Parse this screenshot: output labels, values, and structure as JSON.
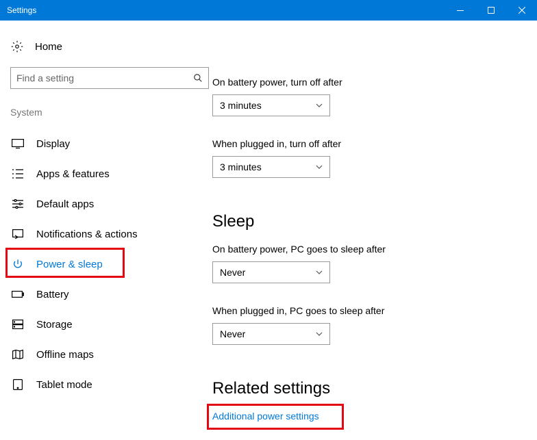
{
  "window": {
    "title": "Settings"
  },
  "home": {
    "label": "Home"
  },
  "search": {
    "placeholder": "Find a setting"
  },
  "section": {
    "label": "System"
  },
  "nav": {
    "items": [
      {
        "label": "Display"
      },
      {
        "label": "Apps & features"
      },
      {
        "label": "Default apps"
      },
      {
        "label": "Notifications & actions"
      },
      {
        "label": "Power & sleep"
      },
      {
        "label": "Battery"
      },
      {
        "label": "Storage"
      },
      {
        "label": "Offline maps"
      },
      {
        "label": "Tablet mode"
      }
    ]
  },
  "screen": {
    "battery_off_label": "On battery power, turn off after",
    "battery_off_value": "3 minutes",
    "plugged_off_label": "When plugged in, turn off after",
    "plugged_off_value": "3 minutes"
  },
  "sleep": {
    "heading": "Sleep",
    "battery_label": "On battery power, PC goes to sleep after",
    "battery_value": "Never",
    "plugged_label": "When plugged in, PC goes to sleep after",
    "plugged_value": "Never"
  },
  "related": {
    "heading": "Related settings",
    "link": "Additional power settings"
  }
}
